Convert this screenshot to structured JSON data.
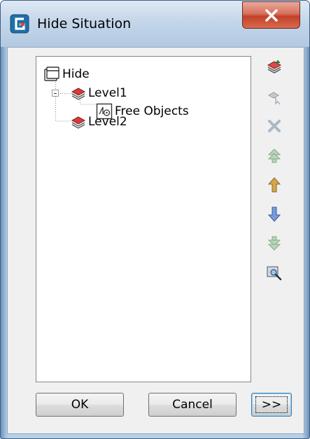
{
  "window": {
    "title": "Hide Situation",
    "app_icon": "app-logo-icon",
    "close_icon": "close-x-icon"
  },
  "tree": {
    "root": {
      "label": "Hide",
      "icon": "hide-folder-icon"
    },
    "level1": {
      "label": "Level1",
      "icon": "layer-stack-icon",
      "expander": "⊟"
    },
    "free_objects": {
      "label": "Free Objects",
      "icon": "free-objects-icon"
    },
    "level2": {
      "label": "Level2",
      "icon": "layer-stack-icon"
    }
  },
  "toolbar": [
    {
      "icon": "add-level-icon",
      "enabled": true
    },
    {
      "icon": "select-objects-icon",
      "enabled": false
    },
    {
      "icon": "delete-icon",
      "enabled": false
    },
    {
      "icon": "move-top-icon",
      "enabled": false
    },
    {
      "icon": "move-up-icon",
      "enabled": true
    },
    {
      "icon": "move-down-icon",
      "enabled": true
    },
    {
      "icon": "move-bottom-icon",
      "enabled": false
    },
    {
      "icon": "zoom-icon",
      "enabled": true
    }
  ],
  "buttons": {
    "ok": "OK",
    "cancel": "Cancel",
    "more": ">>"
  }
}
